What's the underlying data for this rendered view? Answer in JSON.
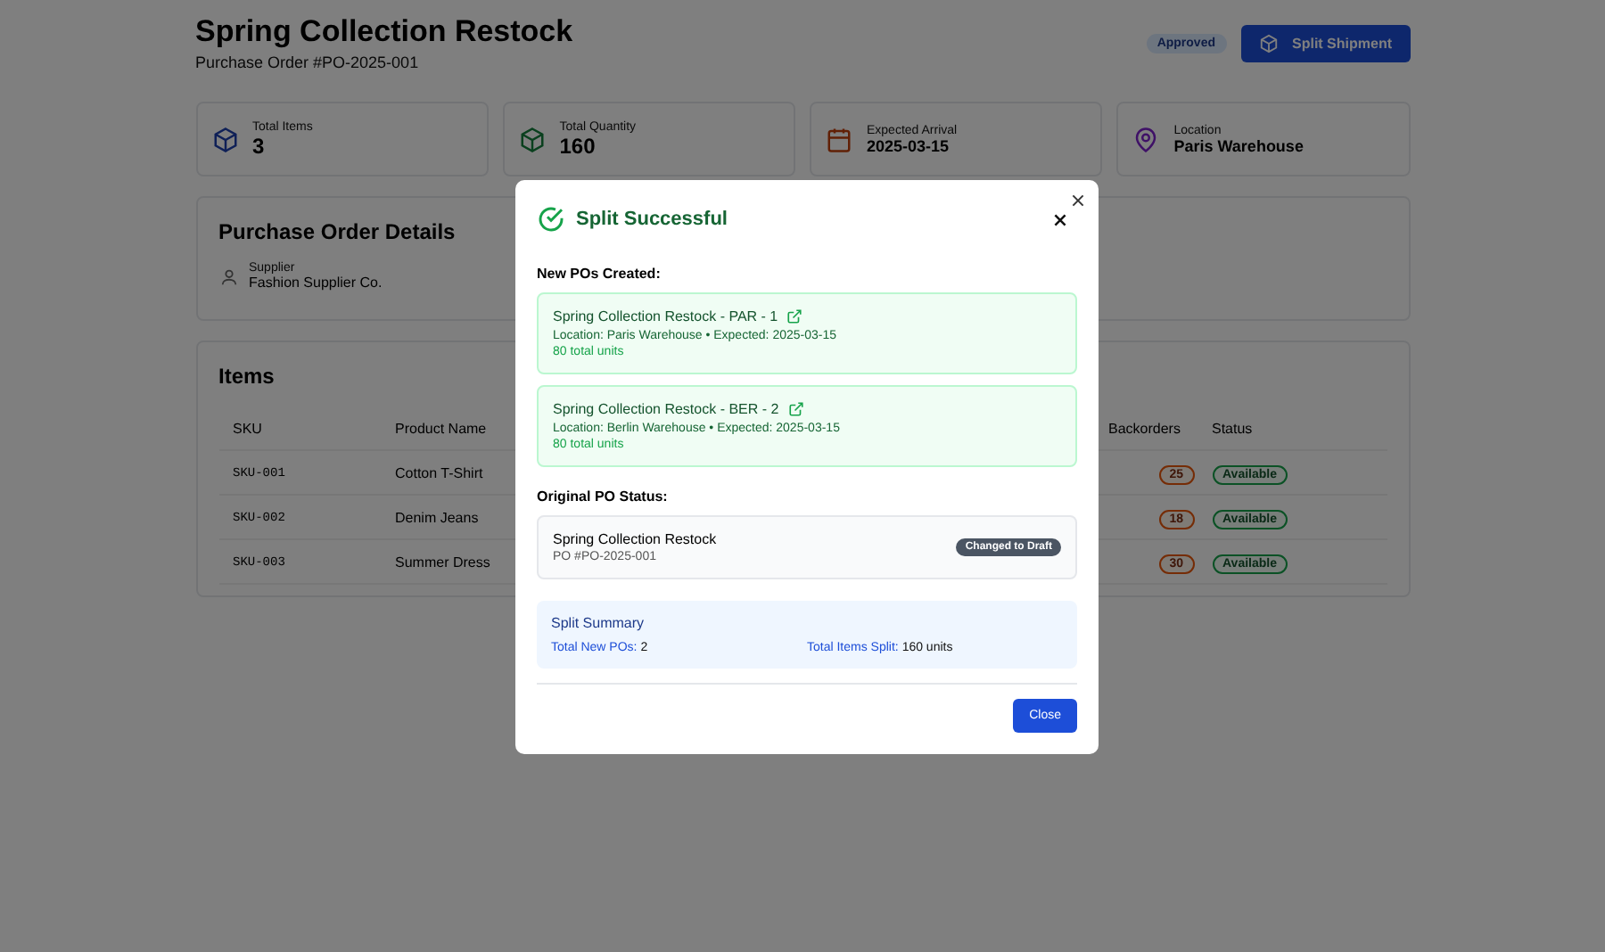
{
  "header": {
    "title": "Spring Collection Restock",
    "subtitle": "Purchase Order #PO-2025-001",
    "status_badge": "Approved",
    "split_button": "Split Shipment"
  },
  "stats": [
    {
      "kind": "box",
      "label": "Total Items",
      "value": "3"
    },
    {
      "kind": "box",
      "label": "Total Quantity",
      "value": "160"
    },
    {
      "kind": "calendar",
      "label": "Expected Arrival",
      "value": "2025-03-15"
    },
    {
      "kind": "pin",
      "label": "Location",
      "value": "Paris Warehouse"
    }
  ],
  "details": {
    "title": "Purchase Order Details",
    "supplier_label": "Supplier",
    "supplier": "Fashion Supplier Co."
  },
  "items": {
    "title": "Items",
    "columns": [
      "SKU",
      "Product Name",
      "Backorders",
      "Status"
    ],
    "rows": [
      {
        "sku": "SKU-001",
        "product": "Cotton T-Shirt",
        "backorders": "25",
        "status": "Available"
      },
      {
        "sku": "SKU-002",
        "product": "Denim Jeans",
        "backorders": "18",
        "status": "Available"
      },
      {
        "sku": "SKU-003",
        "product": "Summer Dress",
        "backorders": "30",
        "status": "Available"
      }
    ]
  },
  "modal": {
    "title": "Split Successful",
    "new_pos_heading": "New POs Created:",
    "new_pos": [
      {
        "name": "Spring Collection Restock - PAR - 1",
        "meta": "Location: Paris Warehouse • Expected: 2025-03-15",
        "units": "80 total units"
      },
      {
        "name": "Spring Collection Restock - BER - 2",
        "meta": "Location: Berlin Warehouse • Expected: 2025-03-15",
        "units": "80 total units"
      }
    ],
    "original_heading": "Original PO Status:",
    "original_name": "Spring Collection Restock",
    "original_po": "PO #PO-2025-001",
    "original_badge": "Changed to Draft",
    "summary_title": "Split Summary",
    "summary": [
      {
        "label": "Total New POs:",
        "value": "2"
      },
      {
        "label": "Total Items Split:",
        "value": "160 units"
      }
    ],
    "close_button": "Close"
  }
}
